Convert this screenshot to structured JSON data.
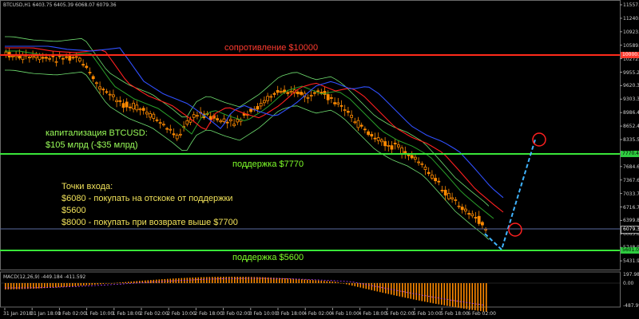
{
  "header": {
    "symbol_line": "BTCUSD,H1  6403.75 6405.39 6068.07 6079.36"
  },
  "annotations": {
    "resistance": "сопротивление $10000",
    "cap_line1": "капитализация BTCUSD:",
    "cap_line2": "$105 млрд (-$35 млрд)",
    "support1": "поддержка $7770",
    "entry_title": "Точки входа:",
    "entry1": "$6080 - покупать на отскоке от поддержки",
    "entry2": "$5600",
    "entry3": "$8000 - покупать при возврате выше $7700",
    "support2": "поддержка $5600"
  },
  "price_axis": [
    "11557.00",
    "11240.05",
    "10923.10",
    "10589.15",
    "10272.20",
    "9955.25",
    "9620.30",
    "9303.35",
    "8986.40",
    "8652.45",
    "8335.50",
    "8001.55",
    "7684.60",
    "7367.65",
    "7033.70",
    "6716.75",
    "6399.80",
    "6065.85",
    "5748.90",
    "5431.95"
  ],
  "price_tags": [
    {
      "label": "10000.00",
      "color": "#ff3b2f",
      "text_color": "#ffffff"
    },
    {
      "label": "7770.46",
      "color": "#2ecc40",
      "text_color": "#000000"
    },
    {
      "label": "6079.36",
      "color": "#000000",
      "text_color": "#ffffff"
    },
    {
      "label": "5601.00",
      "color": "#2ecc40",
      "text_color": "#000000"
    }
  ],
  "macd": {
    "label": "MACD(12,26,9) -449.184 -411.592",
    "axis": [
      "197.984",
      "0.00",
      "-487.999"
    ]
  },
  "time_axis": [
    "31 Jan 2018",
    "31 Jan 18:00",
    "1 Feb 02:00",
    "1 Feb 10:00",
    "1 Feb 18:00",
    "2 Feb 02:00",
    "2 Feb 10:00",
    "2 Feb 18:00",
    "3 Feb 02:00",
    "3 Feb 10:00",
    "3 Feb 18:00",
    "4 Feb 02:00",
    "4 Feb 10:00",
    "4 Feb 18:00",
    "5 Feb 02:00",
    "5 Feb 10:00",
    "5 Feb 18:00",
    "6 Feb 02:00"
  ],
  "colors": {
    "resistance": "#ff2a1a",
    "support": "#39e639",
    "ma_red": "#ff2020",
    "ma_blue": "#3050ff",
    "ma_green": "#2aa02a",
    "bollinger": "#70e070",
    "candles": "#ff8a00",
    "projection": "#40b4ff",
    "circle": "#ff2020"
  }
}
